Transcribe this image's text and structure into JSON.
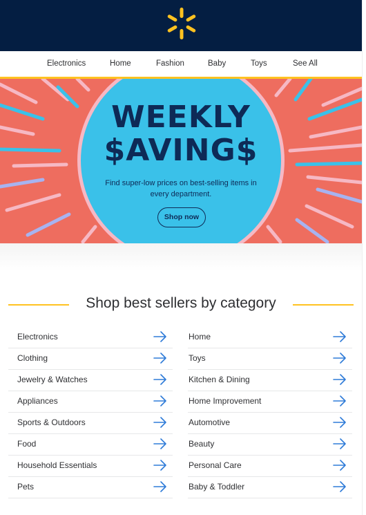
{
  "header": {
    "logo_icon": "walmart-spark-icon",
    "brand_color": "#041e42",
    "accent_color": "#ffc220"
  },
  "nav": {
    "items": [
      {
        "label": "Electronics"
      },
      {
        "label": "Home"
      },
      {
        "label": "Fashion"
      },
      {
        "label": "Baby"
      },
      {
        "label": "Toys"
      },
      {
        "label": "See All"
      }
    ]
  },
  "banner": {
    "title_line1": "WEEKLY",
    "title_line2": "$AVING$",
    "subtitle": "Find super-low prices on best-selling items in every department.",
    "button_label": "Shop now",
    "background_color": "#ee6d5f",
    "circle_color": "#3ac1e9"
  },
  "categories_section": {
    "title": "Shop best sellers by category",
    "arrow_icon": "arrow-right-icon",
    "left": [
      {
        "label": "Electronics"
      },
      {
        "label": "Clothing"
      },
      {
        "label": "Jewelry & Watches"
      },
      {
        "label": "Appliances"
      },
      {
        "label": "Sports & Outdoors"
      },
      {
        "label": "Food"
      },
      {
        "label": "Household Essentials"
      },
      {
        "label": "Pets"
      }
    ],
    "right": [
      {
        "label": "Home"
      },
      {
        "label": "Toys"
      },
      {
        "label": "Kitchen & Dining"
      },
      {
        "label": "Home Improvement"
      },
      {
        "label": "Automotive"
      },
      {
        "label": "Beauty"
      },
      {
        "label": "Personal Care"
      },
      {
        "label": "Baby & Toddler"
      }
    ]
  }
}
